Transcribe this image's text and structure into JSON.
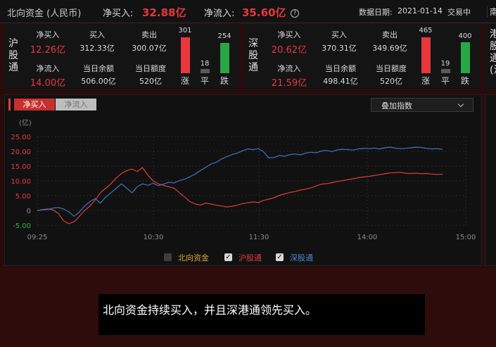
{
  "header": {
    "title": "北向资金 (人民币)",
    "net_buy_label": "净买入:",
    "net_buy_value": "32.88亿",
    "net_inflow_label": "净流入:",
    "net_inflow_value": "35.60亿",
    "date_label": "数据日期:",
    "date_value": "2021-01-14",
    "status": "交易中",
    "next_tab": "南"
  },
  "sh": {
    "name": "沪股通",
    "net_buy_label": "净买入",
    "net_buy": "12.26亿",
    "buy_label": "买入",
    "buy": "312.33亿",
    "sell_label": "卖出",
    "sell": "300.07亿",
    "net_inflow_label": "净流入",
    "net_inflow": "14.00亿",
    "balance_label": "当日余额",
    "balance": "506.00亿",
    "quota_label": "当日额度",
    "quota": "520亿",
    "up_count": "301",
    "flat_count": "18",
    "down_count": "254",
    "up_label": "涨",
    "flat_label": "平",
    "down_label": "跌"
  },
  "sz": {
    "name": "深股通",
    "net_buy_label": "净买入",
    "net_buy": "20.62亿",
    "buy_label": "买入",
    "buy": "370.31亿",
    "sell_label": "卖出",
    "sell": "349.69亿",
    "net_inflow_label": "净流入",
    "net_inflow": "21.59亿",
    "balance_label": "当日余额",
    "balance": "498.41亿",
    "quota_label": "当日额度",
    "quota": "520亿",
    "up_count": "465",
    "flat_count": "19",
    "down_count": "400",
    "up_label": "涨",
    "flat_label": "平",
    "down_label": "跌"
  },
  "partial_panel": {
    "text": "港股通(沪"
  },
  "tabs": {
    "net_buy": "净买入",
    "net_inflow": "净流入"
  },
  "overlay_select": {
    "value": "叠加指数"
  },
  "legend": {
    "north": "北向资金",
    "sh": "沪股通",
    "sz": "深股通"
  },
  "caption": "北向资金持续买入，并且深港通领先买入。",
  "colors": {
    "up": "#e8383c",
    "down": "#27a745",
    "sh_line": "#e23c3c",
    "sz_line": "#3c74c9",
    "north_legend": "#d8a434"
  },
  "chart_data": {
    "type": "line",
    "unit": "(亿)",
    "ylim": [
      -5,
      25
    ],
    "yticks": [
      "25.00",
      "20.00",
      "15.00",
      "10.00",
      "5.00",
      "0",
      "-5.00"
    ],
    "xticks": [
      "09:25",
      "10:30",
      "11:30",
      "14:00",
      "15:00"
    ],
    "grid": true,
    "series": [
      {
        "name": "沪股通",
        "color": "#e23c3c",
        "values": [
          0,
          0.3,
          0.5,
          0.2,
          -1,
          -3.5,
          -4.5,
          -3.8,
          -2,
          0,
          1.5,
          3.5,
          6,
          7.5,
          9,
          11,
          12.5,
          13.5,
          14,
          13.2,
          14.5,
          12,
          10,
          9,
          8.5,
          8,
          7.5,
          6,
          4.5,
          3,
          2.2,
          1.8,
          2.5,
          2.2,
          1.8,
          1.5,
          1.2,
          1.4,
          1.8,
          2.3,
          2.6,
          2.9,
          2.7,
          3.4,
          3.8,
          4.3,
          5.1,
          5.6,
          6.1,
          6.4,
          6.9,
          7.2,
          7.6,
          8.3,
          8.9,
          9.1,
          9.4,
          9.8,
          10.1,
          10.4,
          10.7,
          11.1,
          11.3,
          11.5,
          11.8,
          12.1,
          12.4,
          12.7,
          12.8,
          12.9,
          12.6,
          12.5,
          12.6,
          12.4,
          12.5,
          12.3,
          12.2,
          12.3
        ]
      },
      {
        "name": "深股通",
        "color": "#3c74c9",
        "values": [
          0,
          0.2,
          0.3,
          0.8,
          1,
          0.5,
          -0.5,
          -2,
          -0.5,
          1.5,
          3,
          4,
          2.5,
          4.5,
          6,
          7.5,
          9,
          7.5,
          6,
          8,
          9,
          8.5,
          9.2,
          8.4,
          8.9,
          9.5,
          9.3,
          10.1,
          10.6,
          11.4,
          12.3,
          13.5,
          14.6,
          15.7,
          16.3,
          17.4,
          18.2,
          18.9,
          19.4,
          20.2,
          20.8,
          20.6,
          20.9,
          19.8,
          17.8,
          17.9,
          18.6,
          18.3,
          18.9,
          19.1,
          18.8,
          19.4,
          19.7,
          19.5,
          20.1,
          20.3,
          19.9,
          20.5,
          20.7,
          20.6,
          20.4,
          20.8,
          21,
          20.9,
          21.1,
          20.8,
          21.2,
          21.4,
          21.1,
          20.9,
          21,
          21.2,
          21.4,
          21.3,
          21,
          20.8,
          20.9,
          20.7
        ]
      }
    ]
  }
}
